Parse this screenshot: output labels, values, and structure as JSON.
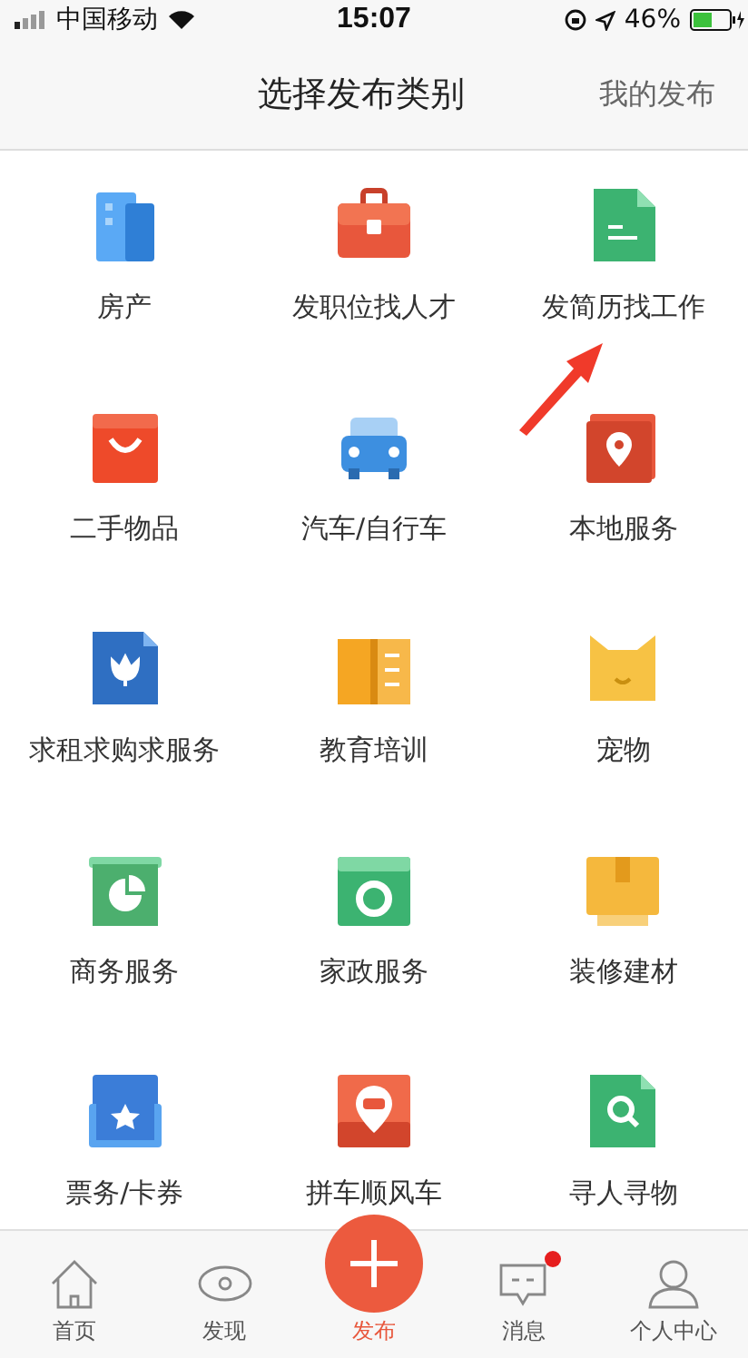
{
  "status_bar": {
    "carrier": "中国移动",
    "time": "15:07",
    "battery": "46%"
  },
  "header": {
    "title": "选择发布类别",
    "action": "我的发布"
  },
  "categories": [
    {
      "label": "房产"
    },
    {
      "label": "发职位找人才"
    },
    {
      "label": "发简历找工作"
    },
    {
      "label": "二手物品"
    },
    {
      "label": "汽车/自行车"
    },
    {
      "label": "本地服务"
    },
    {
      "label": "求租求购求服务"
    },
    {
      "label": "教育培训"
    },
    {
      "label": "宠物"
    },
    {
      "label": "商务服务"
    },
    {
      "label": "家政服务"
    },
    {
      "label": "装修建材"
    },
    {
      "label": "票务/卡券"
    },
    {
      "label": "拼车顺风车"
    },
    {
      "label": "寻人寻物"
    }
  ],
  "tab_bar": [
    {
      "kind": "tab",
      "label": "首页",
      "dot": false
    },
    {
      "kind": "tab",
      "label": "发现",
      "dot": false
    },
    {
      "kind": "publish",
      "label": "发布",
      "dot": false
    },
    {
      "kind": "tab",
      "label": "消息",
      "dot": true
    },
    {
      "kind": "tab",
      "label": "个人中心",
      "dot": false
    }
  ]
}
